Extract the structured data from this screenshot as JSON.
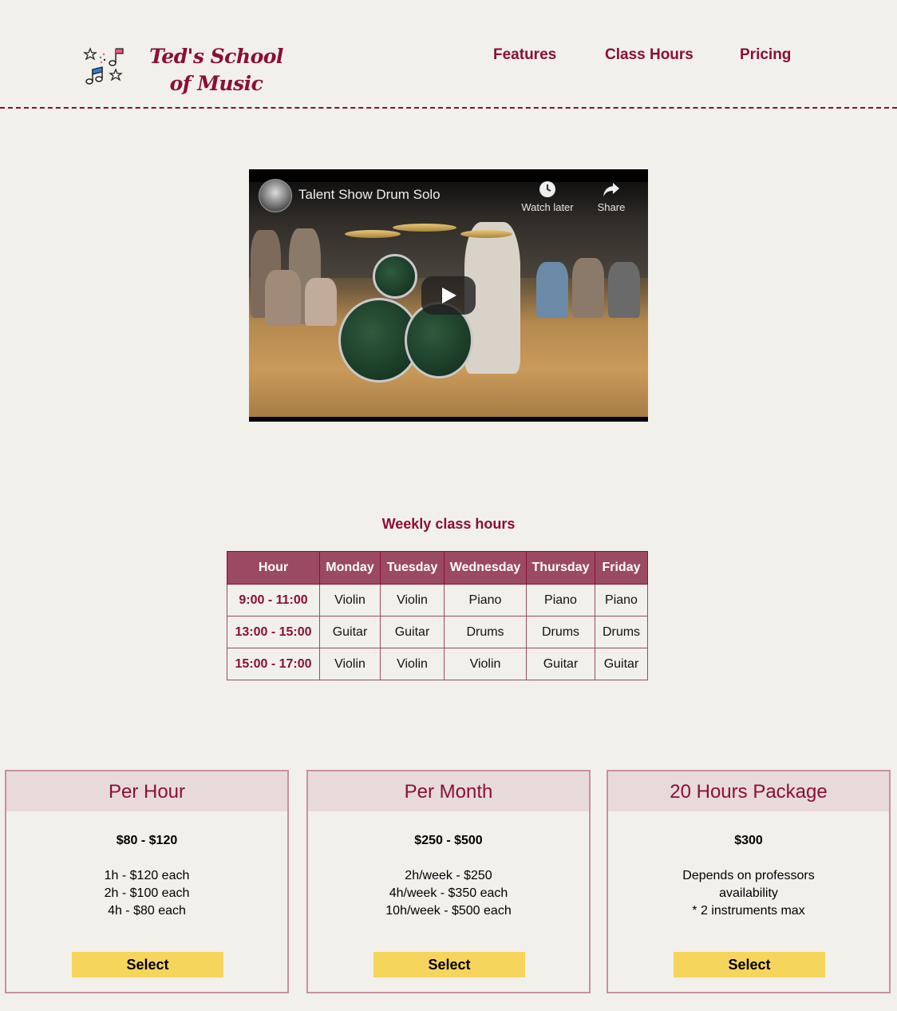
{
  "header": {
    "logo_text": "Ted's School of Music",
    "nav": [
      "Features",
      "Class Hours",
      "Pricing"
    ]
  },
  "video": {
    "title": "Talent Show Drum Solo",
    "watch_later": "Watch later",
    "share": "Share"
  },
  "schedule": {
    "title": "Weekly class hours",
    "headers": [
      "Hour",
      "Monday",
      "Tuesday",
      "Wednesday",
      "Thursday",
      "Friday"
    ],
    "rows": [
      [
        "9:00 - 11:00",
        "Violin",
        "Violin",
        "Piano",
        "Piano",
        "Piano"
      ],
      [
        "13:00 - 15:00",
        "Guitar",
        "Guitar",
        "Drums",
        "Drums",
        "Drums"
      ],
      [
        "15:00 - 17:00",
        "Violin",
        "Violin",
        "Violin",
        "Guitar",
        "Guitar"
      ]
    ]
  },
  "pricing": [
    {
      "title": "Per Hour",
      "price": "$80 - $120",
      "lines": [
        "1h - $120 each",
        "2h - $100 each",
        "4h - $80 each"
      ],
      "button": "Select"
    },
    {
      "title": "Per Month",
      "price": "$250 - $500",
      "lines": [
        "2h/week - $250",
        "4h/week - $350 each",
        "10h/week - $500 each"
      ],
      "button": "Select"
    },
    {
      "title": "20 Hours Package",
      "price": "$300",
      "lines": [
        "Depends on professors",
        "availability",
        "* 2 instruments max"
      ],
      "button": "Select"
    }
  ],
  "colors": {
    "accent": "#8a0f36",
    "table_header": "#9b4a63",
    "button": "#f6d55c",
    "background": "#f2f0eb"
  }
}
